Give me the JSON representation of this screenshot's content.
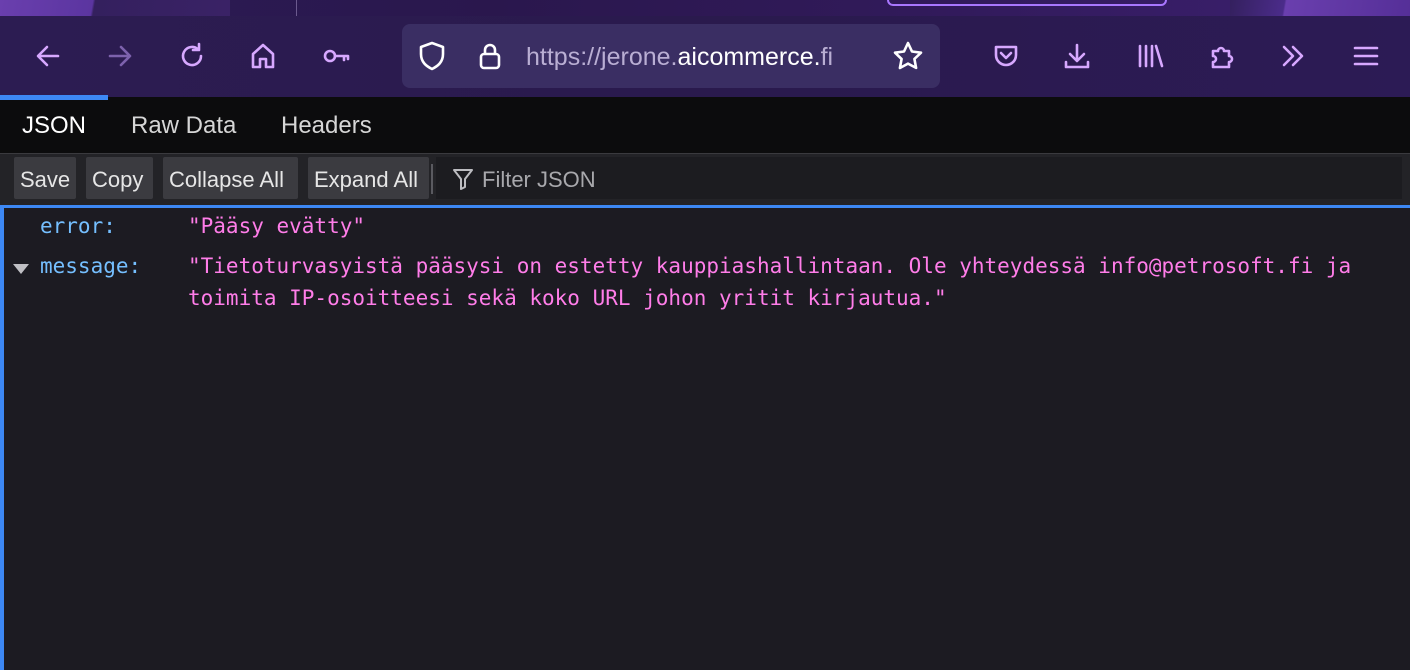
{
  "browser": {
    "url": {
      "scheme": "https://",
      "subdomain": "jerone.",
      "domain": "aicommerce.",
      "rest": "fi"
    }
  },
  "json_viewer": {
    "tabs": [
      {
        "label": "JSON",
        "active": true
      },
      {
        "label": "Raw Data",
        "active": false
      },
      {
        "label": "Headers",
        "active": false
      }
    ],
    "toolbar": {
      "save": "Save",
      "copy": "Copy",
      "collapse_all": "Collapse All",
      "expand_all": "Expand All",
      "filter_placeholder": "Filter JSON"
    },
    "rows": {
      "error_key": "error:",
      "error_value": "\"Pääsy evätty\"",
      "message_key": "message:",
      "message_line1": "\"Tietoturvasyistä pääsysi on estetty kauppiashallintaan. Ole yhteydessä info@petrosoft.fi ja",
      "message_line2": "toimita IP-osoitteesi sekä koko URL johon yritit kirjautua.\""
    }
  },
  "colors": {
    "accent": "#3d88f4",
    "toolbar_icon": "#d7a8ff",
    "json_key": "#75bfff",
    "json_string": "#ff7de9"
  },
  "icons": [
    "back-arrow-icon",
    "forward-arrow-icon",
    "reload-icon",
    "home-icon",
    "key-icon",
    "shield-icon",
    "lock-icon",
    "star-icon",
    "pocket-icon",
    "download-icon",
    "library-icon",
    "extensions-icon",
    "overflow-chevron-icon",
    "menu-icon",
    "filter-icon",
    "collapse-twisty-icon"
  ]
}
